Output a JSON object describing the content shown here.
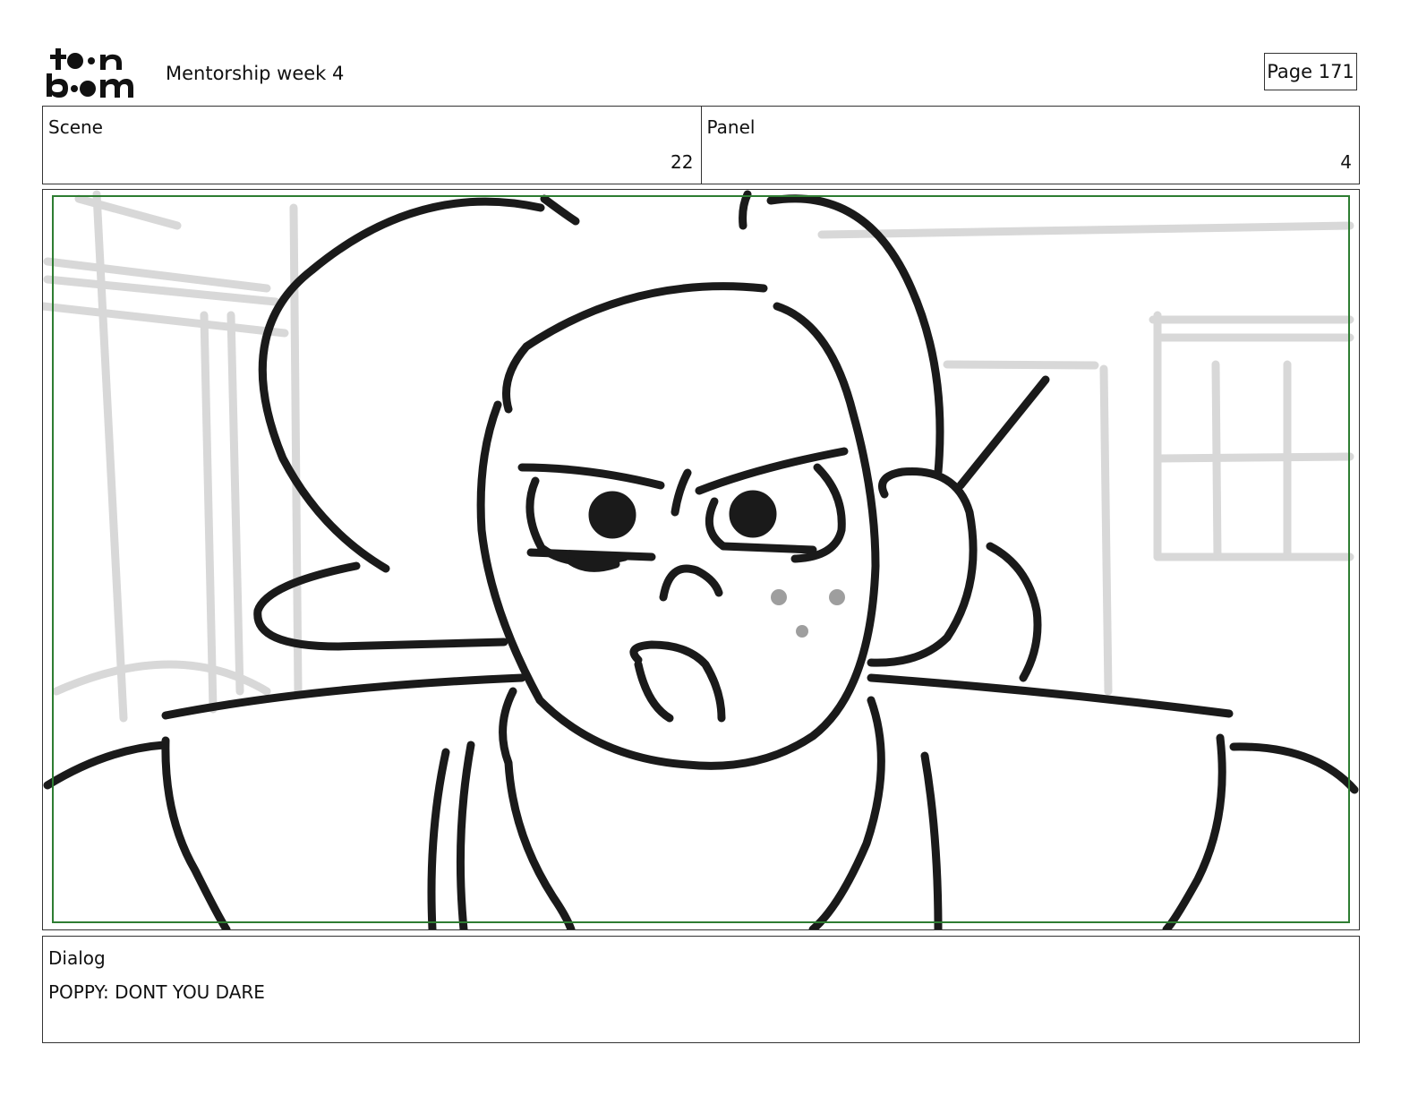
{
  "header": {
    "logo_text_top": "toon",
    "logo_text_bottom": "boom",
    "project_title": "Mentorship week 4",
    "page_label": "Page 171"
  },
  "info": {
    "scene_label": "Scene",
    "scene_value": "22",
    "panel_label": "Panel",
    "panel_value": "4"
  },
  "dialog": {
    "label": "Dialog",
    "text": "POPPY: DONT YOU DARE"
  },
  "colors": {
    "safe_frame": "#2e7d32",
    "ink": "#1a1a1a",
    "background_sketch": "#d6d6d6",
    "freckles": "#9e9e9e"
  }
}
